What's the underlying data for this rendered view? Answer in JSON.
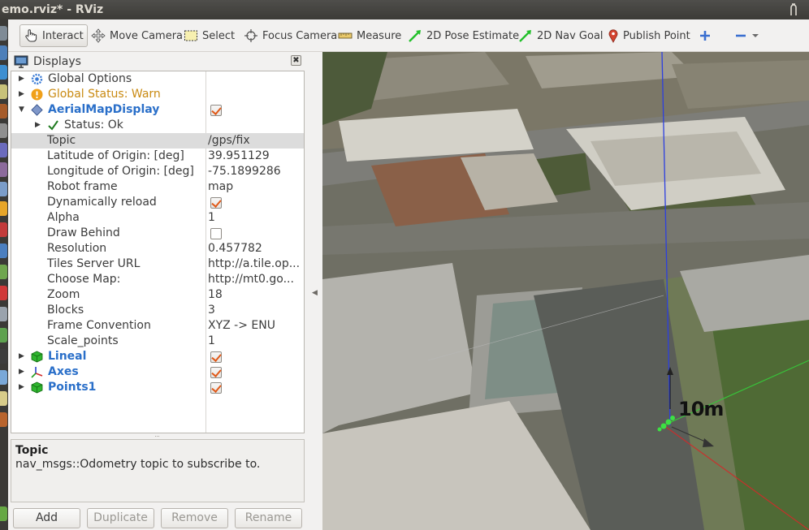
{
  "window": {
    "title": "emo.rviz* - RViz"
  },
  "toolbar": {
    "interact": "Interact",
    "move_camera": "Move Camera",
    "select": "Select",
    "focus_camera": "Focus Camera",
    "measure": "Measure",
    "pose_estimate": "2D Pose Estimate",
    "nav_goal": "2D Nav Goal",
    "publish_point": "Publish Point"
  },
  "displays": {
    "title": "Displays",
    "close": "✖",
    "rows": [
      {
        "name": "Global Options"
      },
      {
        "name": "Global Status: Warn"
      },
      {
        "name": "AerialMapDisplay",
        "checked": true
      },
      {
        "name": "Status: Ok"
      },
      {
        "name": "Topic",
        "value": "/gps/fix"
      },
      {
        "name": "Latitude of Origin: [deg]",
        "value": "39.951129"
      },
      {
        "name": "Longitude of Origin: [deg]",
        "value": "-75.1899286"
      },
      {
        "name": "Robot frame",
        "value": "map"
      },
      {
        "name": "Dynamically reload",
        "checked": true
      },
      {
        "name": "Alpha",
        "value": "1"
      },
      {
        "name": "Draw Behind",
        "checked": false
      },
      {
        "name": "Resolution",
        "value": "0.457782"
      },
      {
        "name": "Tiles Server URL",
        "value": "http://a.tile.op..."
      },
      {
        "name": "Choose Map:",
        "value": "http://mt0.go..."
      },
      {
        "name": "Zoom",
        "value": "18"
      },
      {
        "name": "Blocks",
        "value": "3"
      },
      {
        "name": "Frame Convention",
        "value": "XYZ -> ENU"
      },
      {
        "name": "Scale_points",
        "value": "1"
      },
      {
        "name": "Lineal",
        "checked": true
      },
      {
        "name": "Axes",
        "checked": true
      },
      {
        "name": "Points1",
        "checked": true
      }
    ]
  },
  "description": {
    "title": "Topic",
    "text": "nav_msgs::Odometry topic to subscribe to."
  },
  "buttons": {
    "add": "Add",
    "duplicate": "Duplicate",
    "remove": "Remove",
    "rename": "Rename"
  },
  "view": {
    "scale_label": "10m"
  },
  "colors": {
    "accent_blue": "#2a6fc9",
    "warn": "#c98a12",
    "check": "#e05a1a",
    "green": "#22c02a"
  }
}
